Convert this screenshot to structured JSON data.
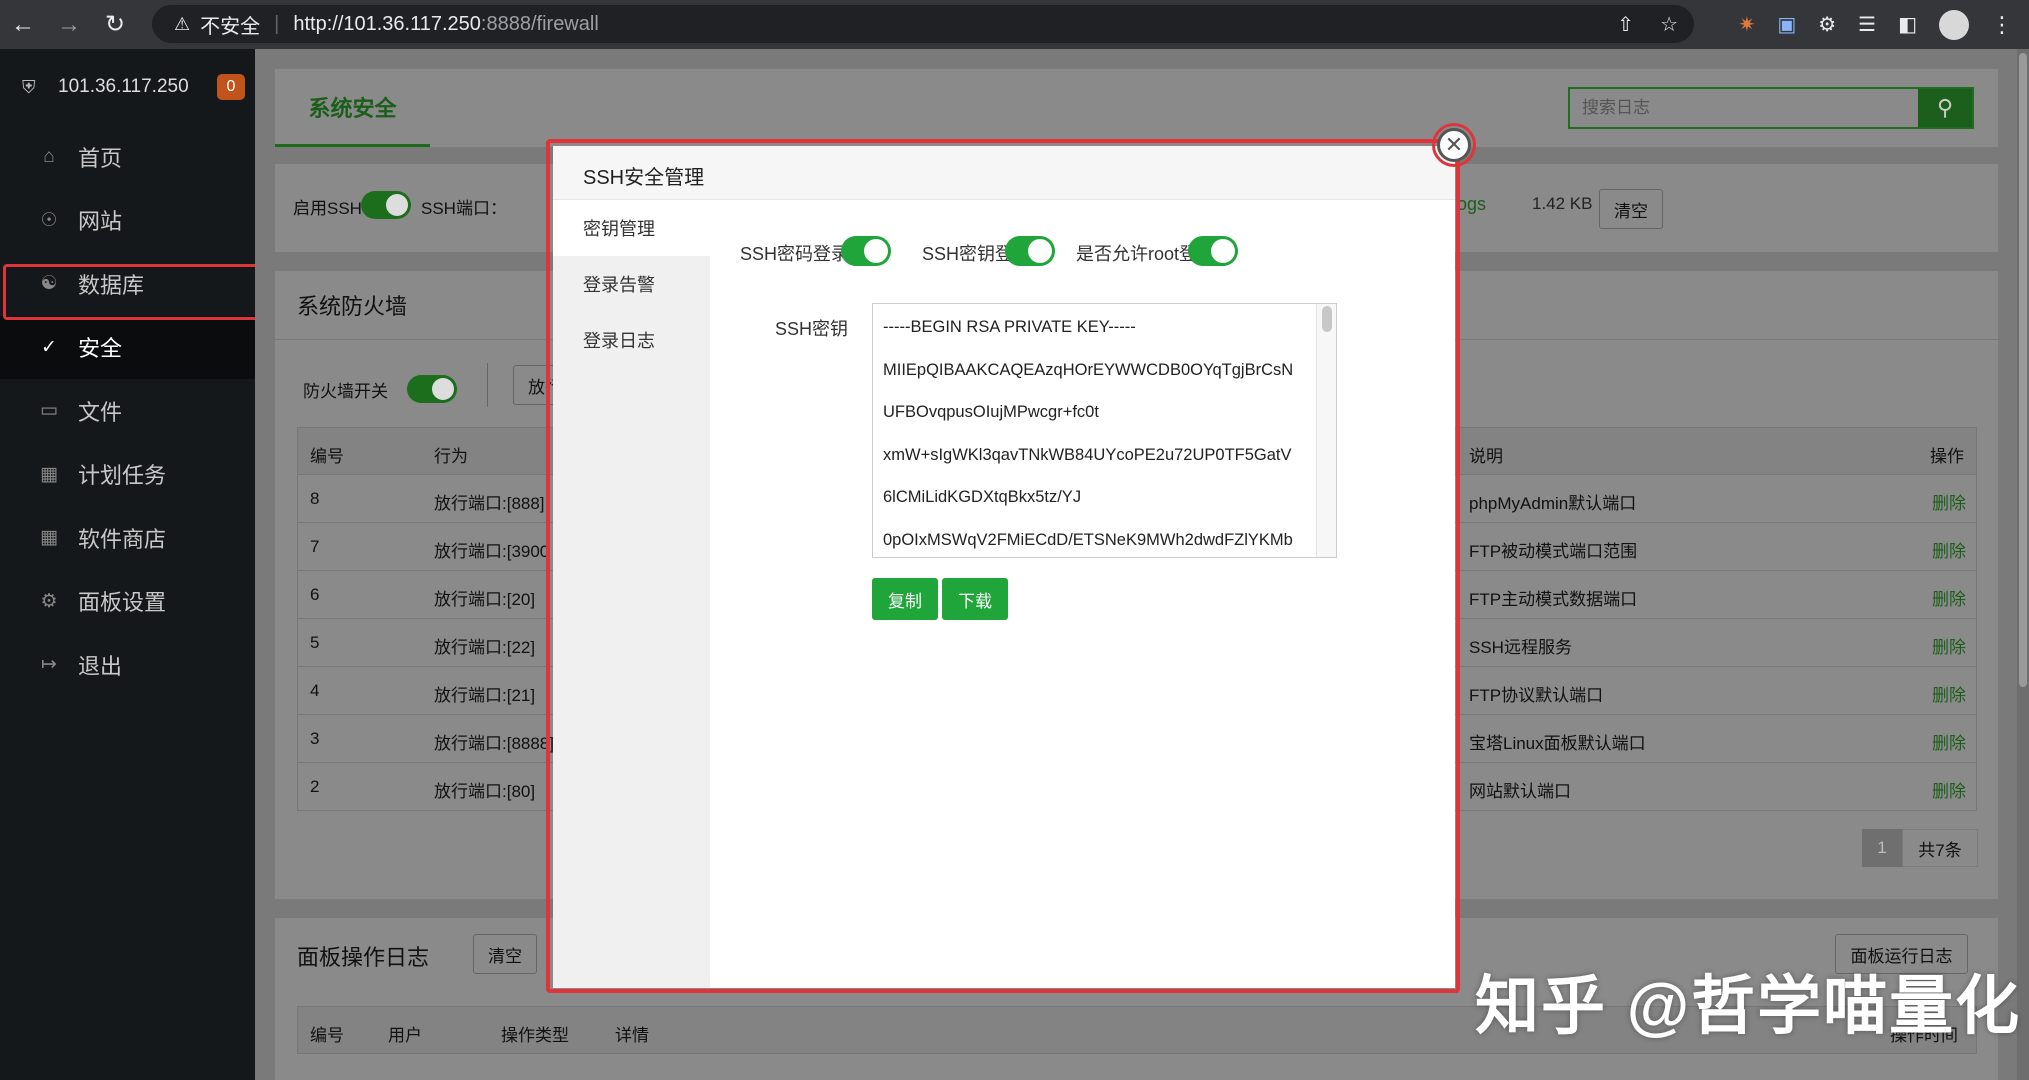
{
  "browser": {
    "insecure_label": "不安全",
    "url_host": "http://101.36.117.250",
    "url_rest": ":8888/firewall"
  },
  "sidebar": {
    "server_ip": "101.36.117.250",
    "badge": "0",
    "items": [
      {
        "label": "首页",
        "icon": "home-icon"
      },
      {
        "label": "网站",
        "icon": "globe-icon"
      },
      {
        "label": "数据库",
        "icon": "database-icon"
      },
      {
        "label": "安全",
        "icon": "shield-icon"
      },
      {
        "label": "文件",
        "icon": "folder-icon"
      },
      {
        "label": "计划任务",
        "icon": "calendar-icon"
      },
      {
        "label": "软件商店",
        "icon": "grid-icon"
      },
      {
        "label": "面板设置",
        "icon": "gear-icon"
      },
      {
        "label": "退出",
        "icon": "logout-icon"
      }
    ]
  },
  "header": {
    "tab": "系统安全",
    "search_placeholder": "搜索日志"
  },
  "ssh_bar": {
    "enable_ssh": "启用SSH",
    "ssh_port": "SSH端口：",
    "logs": "ogs",
    "log_size": "1.42 KB",
    "clear": "清空"
  },
  "firewall": {
    "title": "系统防火墙",
    "switch_label": "防火墙开关",
    "add_btn": "放行",
    "columns": [
      "编号",
      "行为",
      "说明",
      "操作"
    ],
    "rows": [
      {
        "id": "8",
        "action": "放行端口:[888]",
        "desc": "phpMyAdmin默认端口",
        "op": "删除"
      },
      {
        "id": "7",
        "action": "放行端口:[3900",
        "desc": "FTP被动模式端口范围",
        "op": "删除"
      },
      {
        "id": "6",
        "action": "放行端口:[20]",
        "desc": "FTP主动模式数据端口",
        "op": "删除"
      },
      {
        "id": "5",
        "action": "放行端口:[22]",
        "desc": "SSH远程服务",
        "op": "删除"
      },
      {
        "id": "4",
        "action": "放行端口:[21]",
        "desc": "FTP协议默认端口",
        "op": "删除"
      },
      {
        "id": "3",
        "action": "放行端口:[8888]",
        "desc": "宝塔Linux面板默认端口",
        "op": "删除"
      },
      {
        "id": "2",
        "action": "放行端口:[80]",
        "desc": "网站默认端口",
        "op": "删除"
      }
    ],
    "page": "1",
    "total": "共7条"
  },
  "panel_log": {
    "title": "面板操作日志",
    "clear": "清空",
    "run_log_btn": "面板运行日志",
    "columns": [
      "编号",
      "用户",
      "操作类型",
      "详情",
      "操作时间"
    ]
  },
  "modal": {
    "title": "SSH安全管理",
    "tabs": [
      "密钥管理",
      "登录告警",
      "登录日志"
    ],
    "opt_password_login": "SSH密码登录",
    "opt_key_login": "SSH密钥登录",
    "opt_root_login": "是否允许root登录",
    "key_label": "SSH密钥",
    "key_lines": [
      "-----BEGIN RSA PRIVATE KEY-----",
      "MIIEpQIBAAKCAQEAzqHOrEYWWCDB0OYqTgjBrCsN",
      "UFBOvqpusOIujMPwcgr+fc0t",
      "xmW+sIgWKl3qavTNkWB84UYcoPE2u72UP0TF5GatV",
      "6lCMiLidKGDXtqBkx5tz/YJ",
      "0pOIxMSWqV2FMiECdD/ETSNeK9MWh2dwdFZlYKMb"
    ],
    "copy_btn": "复制",
    "download_btn": "下载"
  },
  "watermark": "知乎 @哲学喵量化",
  "colors": {
    "accent_green": "#20a53a",
    "highlight_red": "#e0343a",
    "badge_orange": "#c0541a"
  }
}
